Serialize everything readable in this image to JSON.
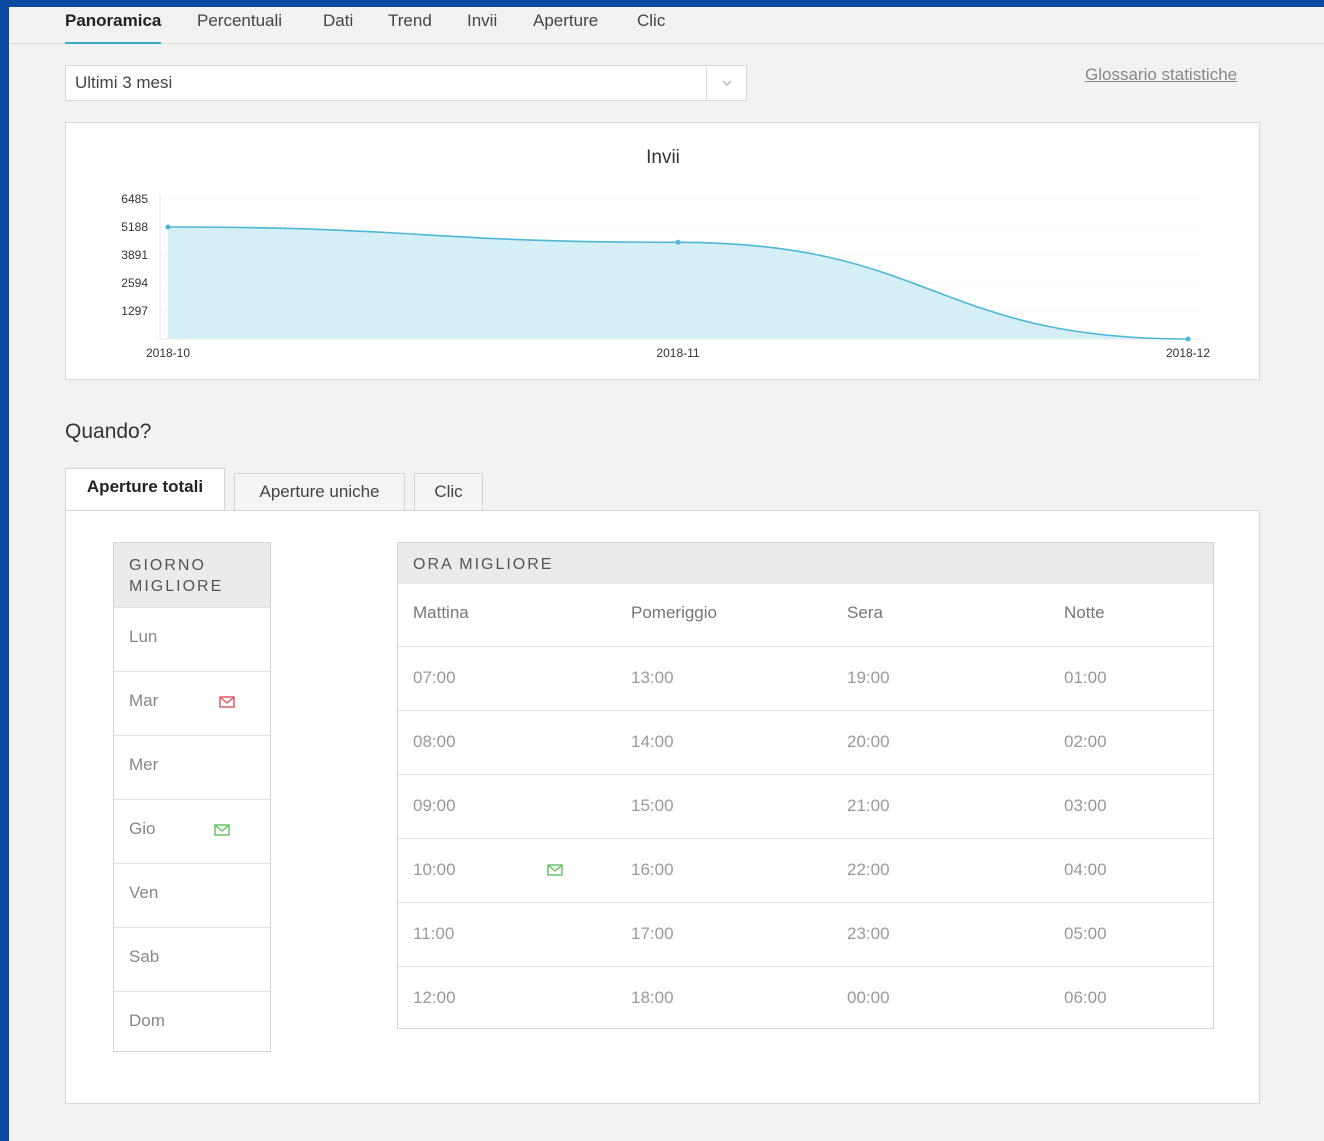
{
  "nav": {
    "tabs": [
      {
        "label": "Panoramica",
        "active": true
      },
      {
        "label": "Percentuali"
      },
      {
        "label": "Dati"
      },
      {
        "label": "Trend"
      },
      {
        "label": "Invii"
      },
      {
        "label": "Aperture"
      },
      {
        "label": "Clic"
      }
    ]
  },
  "period": {
    "selected": "Ultimi 3 mesi"
  },
  "glossary_label": "Glossario statistiche",
  "chart_data": {
    "type": "area",
    "title": "Invii",
    "x": [
      "2018-10",
      "2018-11",
      "2018-12"
    ],
    "values": [
      5188,
      4480,
      0
    ],
    "yticks": [
      1297,
      2594,
      3891,
      5188,
      6485
    ],
    "ylim": [
      0,
      6485
    ],
    "grid": true,
    "color": "#4db8d6",
    "fill": "#d4eff6"
  },
  "section_title": "Quando?",
  "subtabs": [
    {
      "label": "Aperture totali",
      "active": true
    },
    {
      "label": "Aperture uniche"
    },
    {
      "label": "Clic"
    }
  ],
  "best_day": {
    "header": "GIORNO MIGLIORE",
    "days": [
      {
        "label": "Lun"
      },
      {
        "label": "Mar",
        "icon": "envelope-red-icon"
      },
      {
        "label": "Mer"
      },
      {
        "label": "Gio",
        "icon": "envelope-green-icon"
      },
      {
        "label": "Ven"
      },
      {
        "label": "Sab"
      },
      {
        "label": "Dom"
      }
    ]
  },
  "best_hour": {
    "header": "ORA MIGLIORE",
    "columns": [
      "Mattina",
      "Pomeriggio",
      "Sera",
      "Notte"
    ],
    "rows": [
      [
        "07:00",
        "13:00",
        "19:00",
        "01:00"
      ],
      [
        "08:00",
        "14:00",
        "20:00",
        "02:00"
      ],
      [
        "09:00",
        "15:00",
        "21:00",
        "03:00"
      ],
      [
        "10:00",
        "16:00",
        "22:00",
        "04:00"
      ],
      [
        "11:00",
        "17:00",
        "23:00",
        "05:00"
      ],
      [
        "12:00",
        "18:00",
        "00:00",
        "06:00"
      ]
    ],
    "highlight": {
      "row": 3,
      "col": 0,
      "icon": "envelope-green-icon"
    }
  },
  "colors": {
    "red_icon": "#e0505a",
    "green_icon": "#5cc05c",
    "accent": "#3aa8c8"
  }
}
